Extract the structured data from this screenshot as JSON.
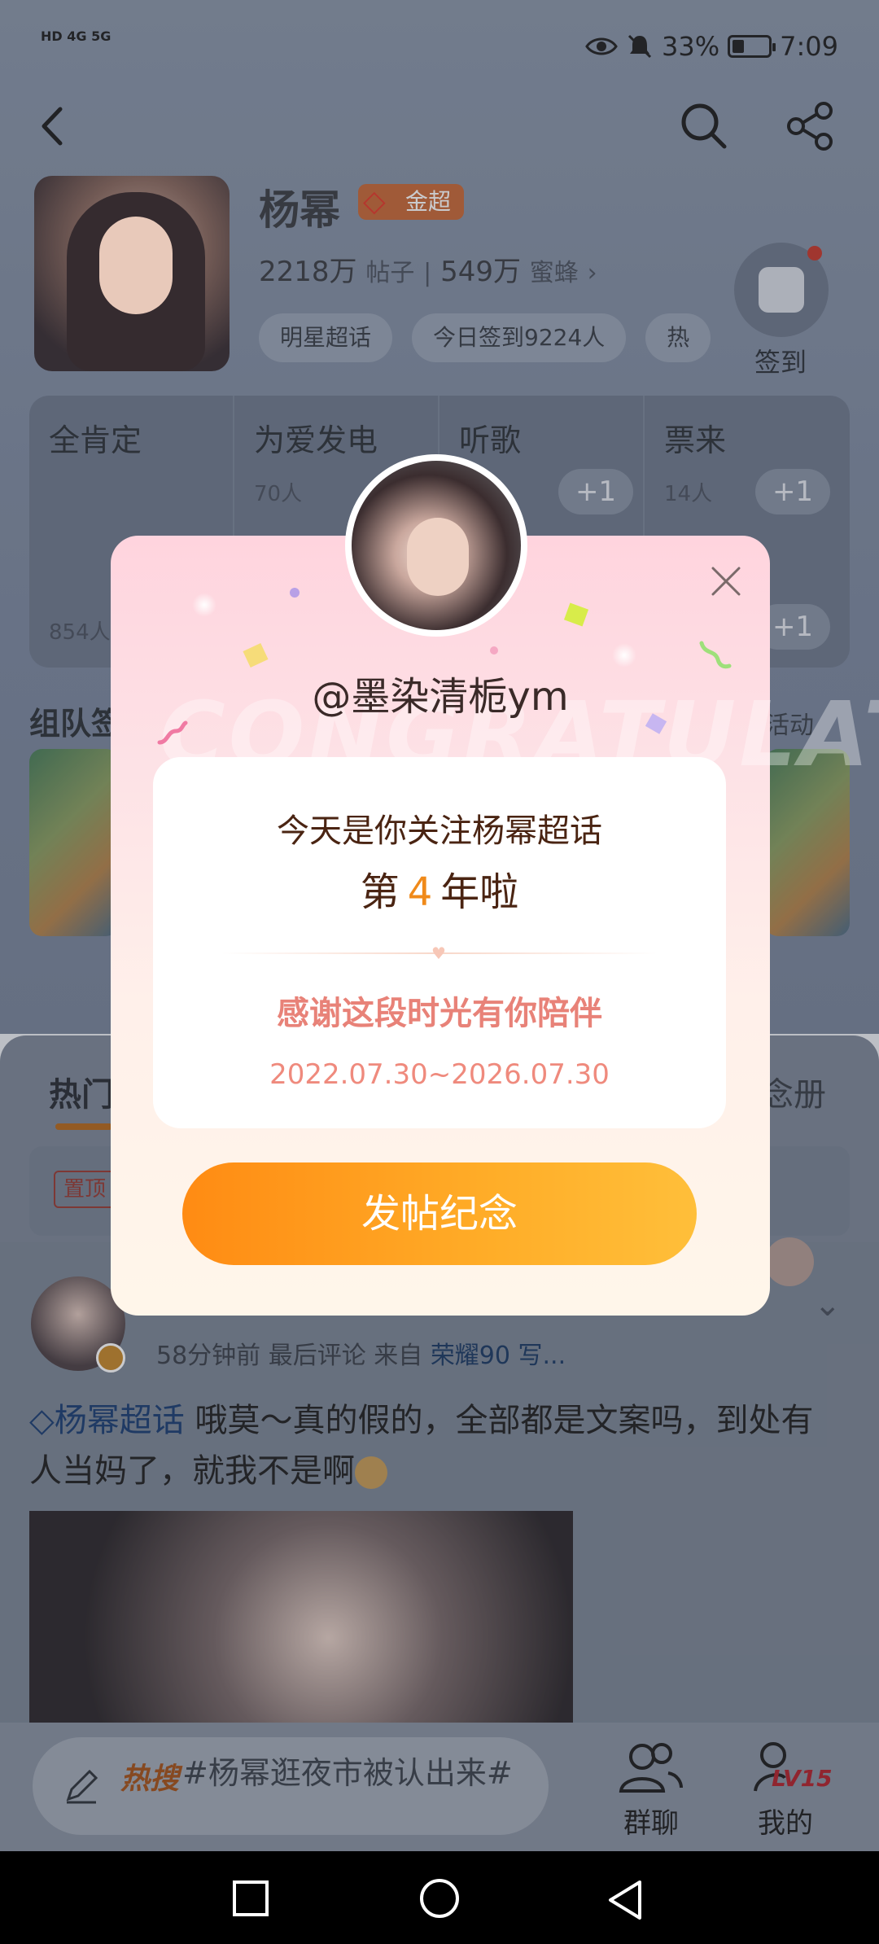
{
  "status_bar": {
    "left": "HD 4G 5G",
    "battery": "33%",
    "time": "7:09"
  },
  "profile": {
    "name": "杨幂",
    "badge": "金超",
    "posts_count": "2218万",
    "posts_label": "帖子",
    "fans_count": "549万",
    "fans_label": "蜜蜂",
    "chips": [
      "明星超话",
      "今日签到9224人",
      "热"
    ],
    "checkin_label": "签到"
  },
  "cards": [
    {
      "title": "全肯定",
      "count": "854人"
    },
    {
      "title": "为爱发电",
      "count": "70人"
    },
    {
      "title": "听歌",
      "count": ""
    },
    {
      "title": "票来",
      "count": "14人"
    }
  ],
  "plus_one": "+1",
  "section": {
    "title": "组队签",
    "more": "活动"
  },
  "feed": {
    "tab_hot": "热门",
    "tab_album": "念册",
    "pin_tag": "置顶",
    "post_meta_time": "58分钟前 最后评论",
    "post_meta_from": "来自",
    "post_meta_device": "荣耀90 写...",
    "post_tag": "杨幂超话",
    "post_body": "哦莫～真的假的，全部都是文案吗，到处有人当妈了，就我不是啊"
  },
  "bottom_bar": {
    "hot_label": "热搜",
    "hot_text": "#杨幂逛夜市被认出来#",
    "group_chat": "群聊",
    "me": "我的",
    "level": "LV15"
  },
  "modal": {
    "watermark": "CONGRATULATE",
    "username": "@墨染清栀ym",
    "line1": "今天是你关注杨幂超话",
    "line2_prefix": "第",
    "line2_number": "4",
    "line2_suffix": "年啦",
    "thanks": "感谢这段时光有你陪伴",
    "dates": "2022.07.30~2026.07.30",
    "button": "发帖纪念"
  }
}
